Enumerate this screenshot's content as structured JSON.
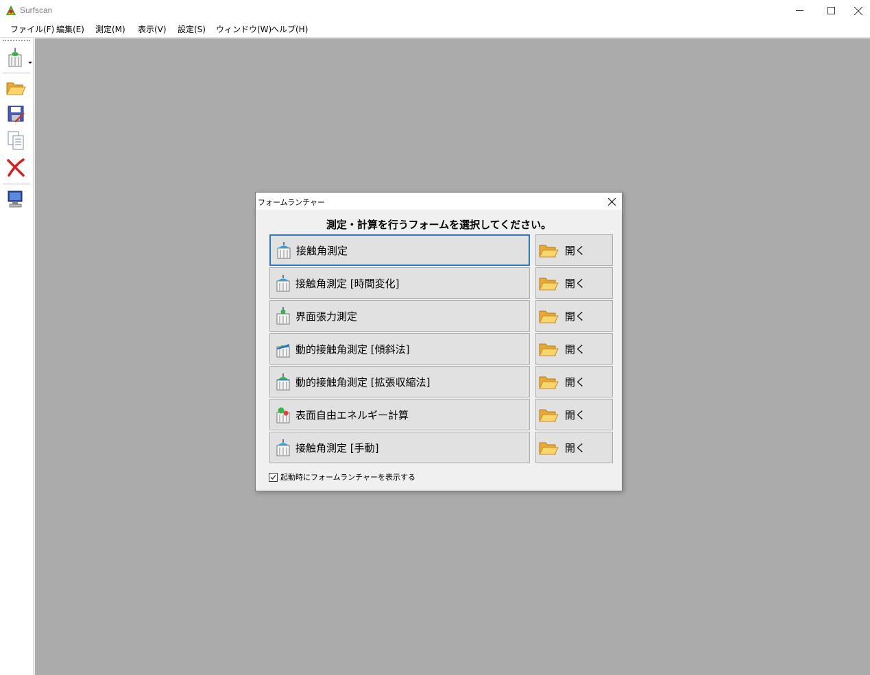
{
  "window": {
    "title": "Surfscan"
  },
  "menu": [
    "ファイル(F)",
    "編集(E)",
    "測定(M)",
    "表示(V)",
    "設定(S)",
    "ウィンドウ(W)",
    "ヘルプ(H)"
  ],
  "toolbar": {
    "items": [
      {
        "name": "new-measurement",
        "icon": "measurement-icon"
      },
      {
        "name": "open",
        "icon": "folder-open-icon"
      },
      {
        "name": "save",
        "icon": "save-icon"
      },
      {
        "name": "copy",
        "icon": "copy-icon"
      },
      {
        "name": "delete",
        "icon": "delete-icon"
      },
      {
        "name": "device",
        "icon": "computer-icon"
      }
    ]
  },
  "dialog": {
    "title": "フォームランチャー",
    "heading": "測定・計算を行うフォームを選択してください。",
    "open_label": "開く",
    "forms": [
      {
        "label": "接触角測定",
        "icon": "contact-angle-icon"
      },
      {
        "label": "接触角測定 [時間変化]",
        "icon": "contact-angle-time-icon"
      },
      {
        "label": "界面張力測定",
        "icon": "interfacial-tension-icon"
      },
      {
        "label": "動的接触角測定 [傾斜法]",
        "icon": "dynamic-tilt-icon"
      },
      {
        "label": "動的接触角測定 [拡張収縮法]",
        "icon": "dynamic-expand-icon"
      },
      {
        "label": "表面自由エネルギー計算",
        "icon": "surface-energy-icon"
      },
      {
        "label": "接触角測定 [手動]",
        "icon": "contact-angle-manual-icon"
      }
    ],
    "show_on_startup_label": "起動時にフォームランチャーを表示する",
    "show_on_startup": true
  },
  "colors": {
    "workspace": "#ababab",
    "focus": "#2f78c4",
    "button_face": "#e1e1e1"
  }
}
